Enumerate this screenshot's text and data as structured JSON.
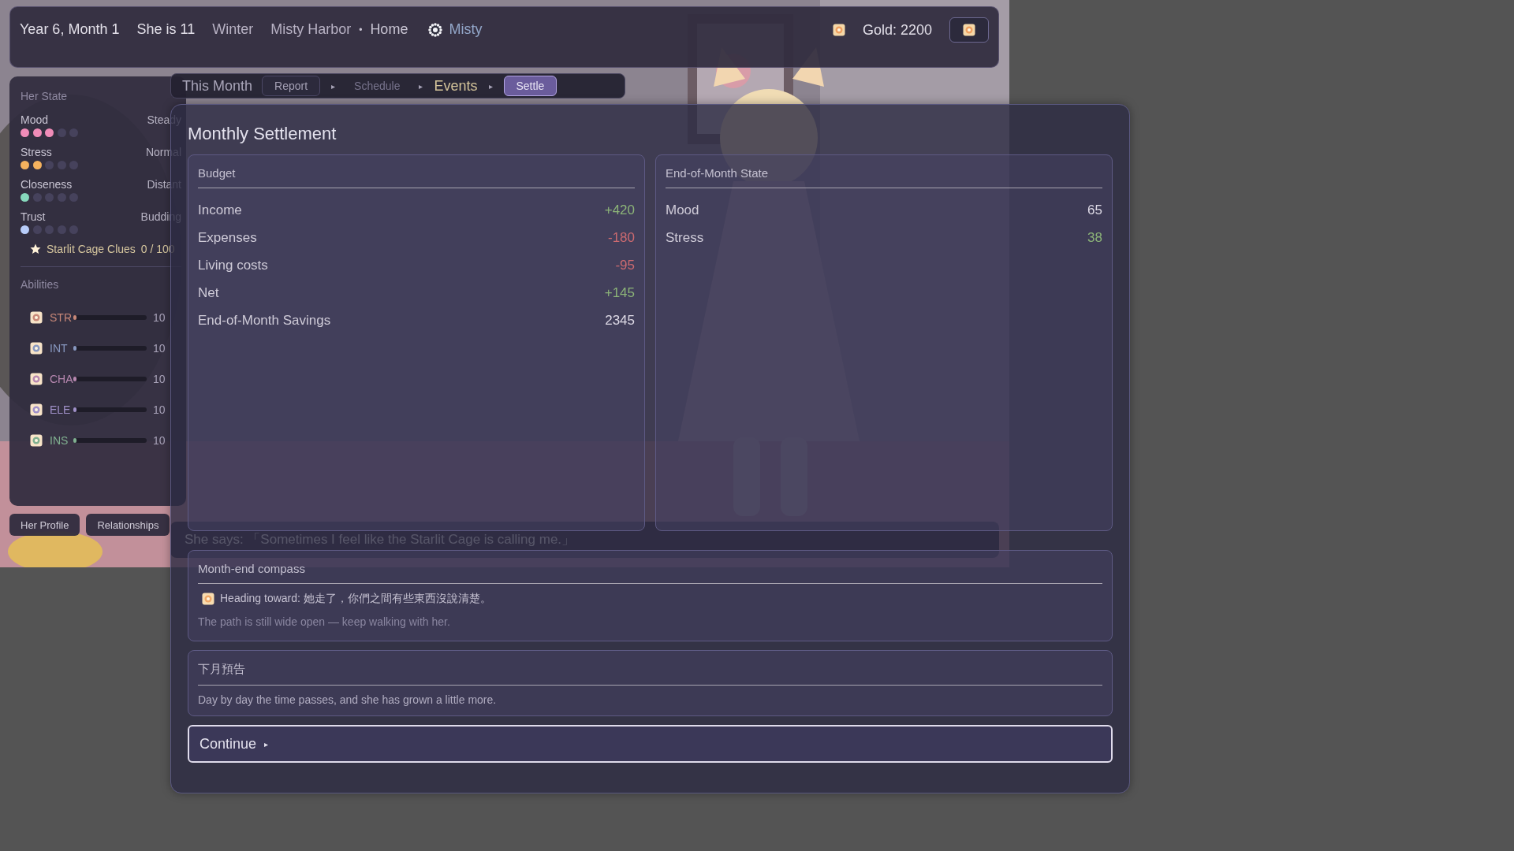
{
  "top_bar": {
    "date": "Year 6, Month 1",
    "age": "She is 11",
    "season": "Winter",
    "location": "Misty Harbor",
    "separator": "•",
    "place": "Home",
    "character": "Misty",
    "gold": "Gold: 2200"
  },
  "state_panel": {
    "title": "Her State",
    "stats": [
      {
        "label": "Mood",
        "value": "Steady",
        "stars": 3,
        "color": "#f08cb8"
      },
      {
        "label": "Stress",
        "value": "Normal",
        "stars": 2,
        "color": "#f5b25e"
      },
      {
        "label": "Closeness",
        "value": "Distant",
        "stars": 1,
        "color": "#86d8bc"
      },
      {
        "label": "Trust",
        "value": "Budding",
        "stars": 1,
        "color": "#b8cdfa"
      }
    ],
    "clues": {
      "label": "Starlit Cage Clues",
      "value": "0 / 100"
    },
    "abilities_title": "Abilities",
    "abilities": [
      {
        "label": "STR",
        "level": 0.03,
        "value": "10",
        "color": "#c88878"
      },
      {
        "label": "INT",
        "level": 0.03,
        "value": "10",
        "color": "#8898c0"
      },
      {
        "label": "CHA",
        "level": 0.03,
        "value": "10",
        "color": "#b888b0"
      },
      {
        "label": "ELE",
        "level": 0.03,
        "value": "10",
        "color": "#a090c8"
      },
      {
        "label": "INS",
        "level": 0.03,
        "value": "10",
        "color": "#80b090"
      }
    ]
  },
  "profile_buttons": [
    "Her Profile",
    "Relationships"
  ],
  "dialogue": "She says: 「Sometimes I feel like the Starlit Cage is calling me.」",
  "steps": {
    "title": "This Month",
    "items": [
      {
        "kind": "pill",
        "label": "Report",
        "selected": false,
        "disabled": false
      },
      {
        "kind": "arrow",
        "label": "▸"
      },
      {
        "kind": "plain",
        "label": "Schedule",
        "selected": false,
        "disabled": true
      },
      {
        "kind": "arrow",
        "label": "▸"
      },
      {
        "kind": "plain",
        "label": "Events",
        "selected": false,
        "disabled": false
      },
      {
        "kind": "arrow",
        "label": "▸"
      },
      {
        "kind": "pill",
        "label": "Settle",
        "selected": true,
        "disabled": false
      }
    ]
  },
  "modal": {
    "title": "Monthly Settlement",
    "budget": {
      "title": "Budget",
      "rows": [
        {
          "label": "Income",
          "value": "+420",
          "color": "#8cb478"
        },
        {
          "label": "Expenses",
          "value": "-180",
          "color": "#cc6a70"
        },
        {
          "label": "Living costs",
          "value": "-95",
          "color": "#cc6a70"
        },
        {
          "label": "Net",
          "value": "+145",
          "color": "#8cb478"
        },
        {
          "label": "End-of-Month Savings",
          "value": "2345",
          "color": "#dedae6"
        }
      ]
    },
    "state": {
      "title": "End-of-Month State",
      "rows": [
        {
          "label": "Mood",
          "value": "65",
          "color": "#dedae6"
        },
        {
          "label": "Stress",
          "value": "38",
          "color": "#8cb478"
        }
      ]
    },
    "compass": {
      "title": "Month-end compass",
      "heading": "Heading toward: 她走了，你們之間有些東西沒說清楚。",
      "note": "The path is still wide open — keep walking with her."
    },
    "forecast": {
      "title": "下月預告",
      "text": "Day by day the time passes, and she has grown a little more."
    },
    "continue": {
      "label": "Continue",
      "arrow": "▸"
    }
  }
}
